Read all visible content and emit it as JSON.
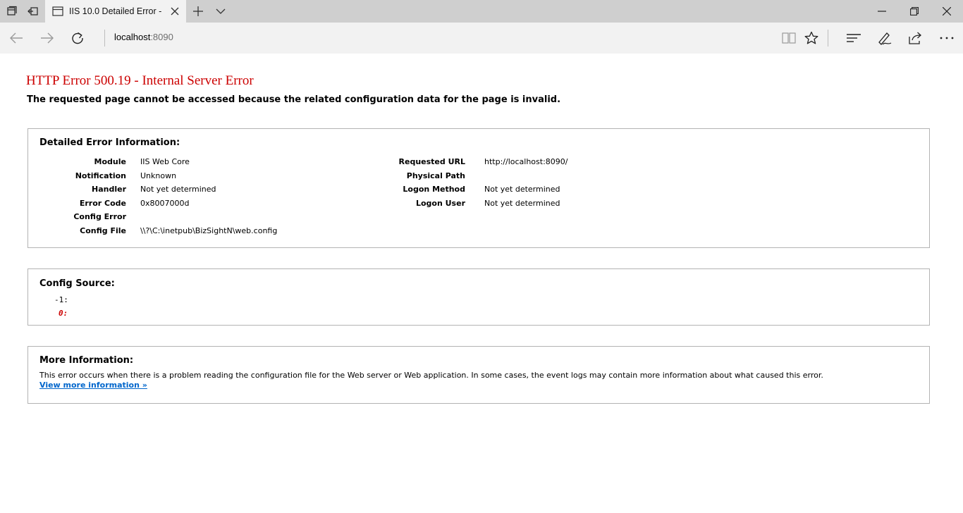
{
  "browser": {
    "tab": {
      "title": "IIS 10.0 Detailed Error -"
    },
    "address": {
      "host": "localhost",
      "port": ":8090"
    }
  },
  "page": {
    "title": "HTTP Error 500.19 - Internal Server Error",
    "subtitle": "The requested page cannot be accessed because the related configuration data for the page is invalid.",
    "detail": {
      "heading": "Detailed Error Information:",
      "left": [
        {
          "key": "Module",
          "value": "IIS Web Core"
        },
        {
          "key": "Notification",
          "value": "Unknown"
        },
        {
          "key": "Handler",
          "value": "Not yet determined"
        },
        {
          "key": "Error Code",
          "value": "0x8007000d"
        },
        {
          "key": "Config Error",
          "value": ""
        },
        {
          "key": "Config File",
          "value": "\\\\?\\C:\\inetpub\\BizSightN\\web.config"
        }
      ],
      "right": [
        {
          "key": "Requested URL",
          "value": "http://localhost:8090/"
        },
        {
          "key": "Physical Path",
          "value": ""
        },
        {
          "key": "Logon Method",
          "value": "Not yet determined"
        },
        {
          "key": "Logon User",
          "value": "Not yet determined"
        }
      ]
    },
    "config_source": {
      "heading": "Config Source:",
      "lines": [
        "-1:",
        "0:"
      ]
    },
    "more_info": {
      "heading": "More Information:",
      "text": "This error occurs when there is a problem reading the configuration file for the Web server or Web application. In some cases, the event logs may contain more information about what caused this error.",
      "link": "View more information »"
    }
  }
}
